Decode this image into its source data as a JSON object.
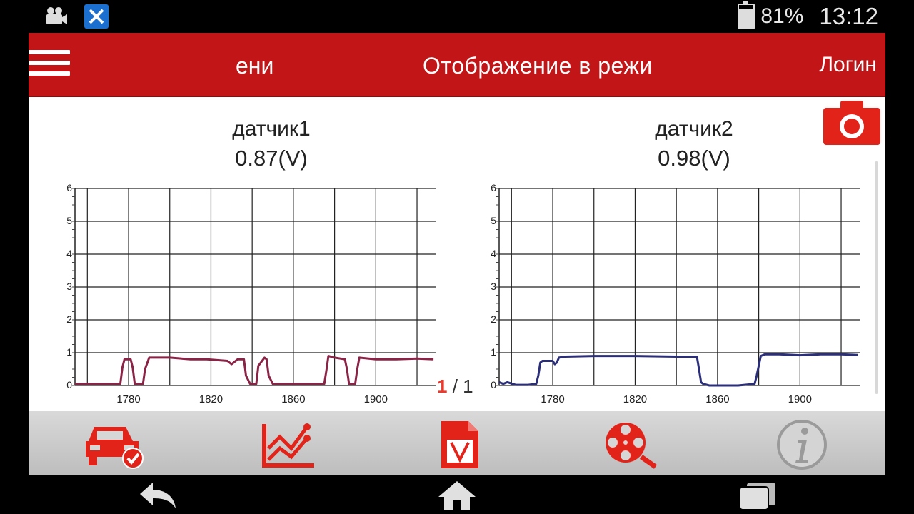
{
  "status_bar": {
    "battery_percent": "81%",
    "battery_level": 0.81,
    "time": "13:12",
    "icons": [
      "video-camera-icon",
      "tools-app-icon",
      "battery-charging-icon"
    ]
  },
  "header": {
    "menu_icon": "hamburger-menu-icon",
    "left_text": "ени",
    "title": "Отображение в режи",
    "login": "Логин"
  },
  "sensors": [
    {
      "name": "датчик1",
      "value": "0.87(V)"
    },
    {
      "name": "датчик2",
      "value": "0.98(V)"
    }
  ],
  "pager": {
    "current": "1",
    "total": " / 1"
  },
  "toolbar": {
    "icons": [
      "car-check-icon",
      "graph-icon",
      "voltage-document-icon",
      "film-search-icon",
      "info-icon"
    ]
  },
  "nav_bar": {
    "icons": [
      "back-icon",
      "home-icon",
      "recent-apps-icon"
    ]
  },
  "colors": {
    "header_red": "#c21517",
    "accent_red": "#e63b2e",
    "series1": "#8b2346",
    "series2": "#2b2f7a"
  },
  "chart_data": [
    {
      "type": "line",
      "title": "",
      "xlabel": "",
      "ylabel": "",
      "xlim": [
        1754,
        1929
      ],
      "ylim": [
        0,
        6
      ],
      "y_ticks": [
        "0",
        "1",
        "2",
        "3",
        "4",
        "5",
        "6"
      ],
      "x_ticks": [
        "1780",
        "1820",
        "1860",
        "1900"
      ],
      "grid": true,
      "series": [
        {
          "color": "#8b2346",
          "x": [
            1754,
            1776,
            1777,
            1778,
            1781,
            1782,
            1783,
            1785,
            1787,
            1788,
            1790,
            1800,
            1810,
            1818,
            1828,
            1830,
            1833,
            1836,
            1837,
            1839,
            1840,
            1842,
            1843,
            1846,
            1847,
            1848,
            1850,
            1860,
            1870,
            1875,
            1876,
            1877,
            1880,
            1885,
            1886,
            1887,
            1889,
            1890,
            1891,
            1892,
            1900,
            1910,
            1920,
            1928
          ],
          "y": [
            0.05,
            0.05,
            0.55,
            0.8,
            0.8,
            0.55,
            0.05,
            0.05,
            0.05,
            0.5,
            0.85,
            0.85,
            0.8,
            0.8,
            0.75,
            0.65,
            0.8,
            0.8,
            0.3,
            0.05,
            0.05,
            0.05,
            0.6,
            0.85,
            0.8,
            0.3,
            0.05,
            0.05,
            0.05,
            0.05,
            0.45,
            0.9,
            0.85,
            0.8,
            0.5,
            0.05,
            0.05,
            0.05,
            0.5,
            0.85,
            0.8,
            0.8,
            0.82,
            0.8
          ]
        }
      ]
    },
    {
      "type": "line",
      "title": "",
      "xlabel": "",
      "ylabel": "",
      "xlim": [
        1754,
        1929
      ],
      "ylim": [
        0,
        6
      ],
      "y_ticks": [
        "0",
        "1",
        "2",
        "3",
        "4",
        "5",
        "6"
      ],
      "x_ticks": [
        "1780",
        "1820",
        "1860",
        "1900"
      ],
      "grid": true,
      "series": [
        {
          "color": "#2b2f7a",
          "x": [
            1754,
            1756,
            1758,
            1762,
            1768,
            1772,
            1773,
            1774,
            1775,
            1780,
            1781,
            1782,
            1783,
            1786,
            1800,
            1820,
            1840,
            1850,
            1851,
            1852,
            1853,
            1856,
            1860,
            1870,
            1878,
            1879,
            1880,
            1881,
            1883,
            1890,
            1900,
            1910,
            1920,
            1928
          ],
          "y": [
            0.1,
            0.05,
            0.1,
            0.02,
            0.02,
            0.05,
            0.3,
            0.7,
            0.75,
            0.75,
            0.65,
            0.7,
            0.85,
            0.88,
            0.9,
            0.9,
            0.88,
            0.88,
            0.5,
            0.1,
            0.05,
            0.0,
            0.0,
            0.0,
            0.05,
            0.3,
            0.6,
            0.9,
            0.95,
            0.95,
            0.92,
            0.95,
            0.95,
            0.93
          ]
        }
      ]
    }
  ]
}
